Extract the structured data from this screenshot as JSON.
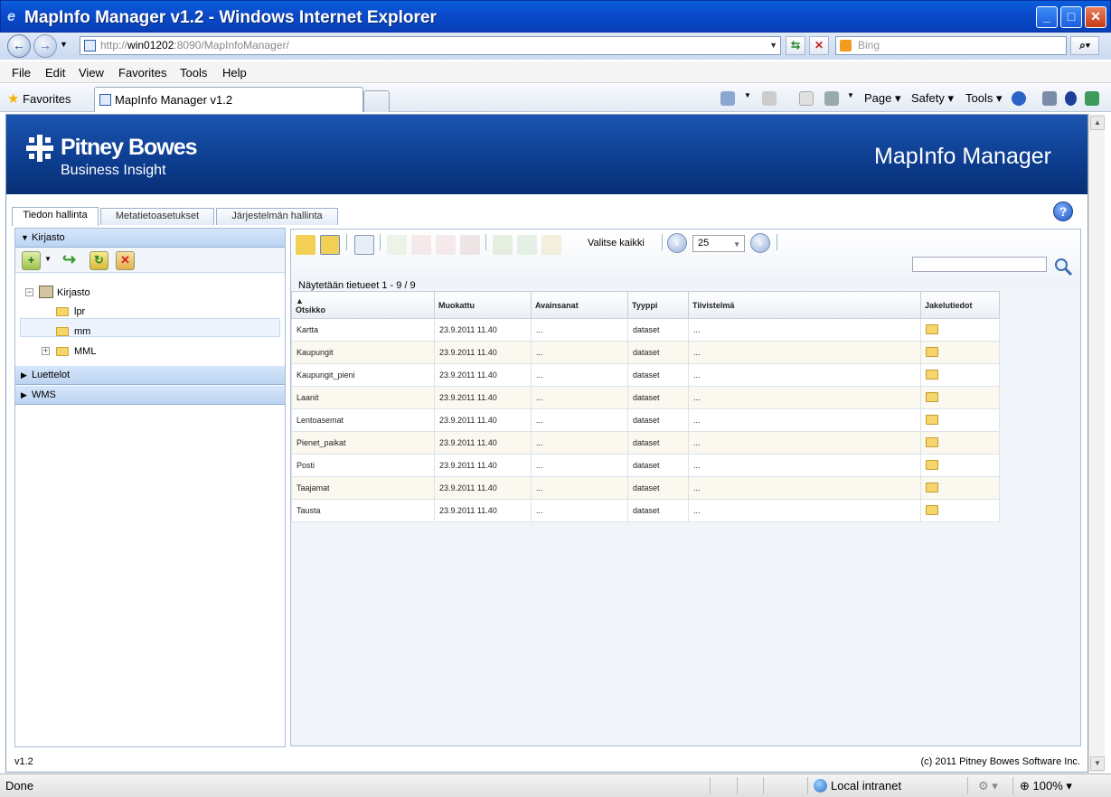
{
  "window": {
    "title": "MapInfo Manager v1.2 - Windows Internet Explorer"
  },
  "address": {
    "url_gray": "http://",
    "url_host": "win01202",
    "url_rest": ":8090/MapInfoManager/",
    "search_placeholder": "Bing"
  },
  "menu": [
    "File",
    "Edit",
    "View",
    "Favorites",
    "Tools",
    "Help"
  ],
  "favorites": {
    "label": "Favorites",
    "tab_title": "MapInfo Manager v1.2"
  },
  "commands": {
    "page": "Page",
    "safety": "Safety",
    "tools": "Tools"
  },
  "header": {
    "brand": "Pitney Bowes",
    "sub": "Business Insight",
    "app_title": "MapInfo Manager"
  },
  "tabs": [
    "Tiedon hallinta",
    "Metatietoasetukset",
    "Järjestelmän hallinta"
  ],
  "left": {
    "accordion": [
      "Kirjasto",
      "Luettelot",
      "WMS"
    ],
    "tree": {
      "root": "Kirjasto",
      "children": [
        "lpr",
        "mm",
        "MML"
      ]
    }
  },
  "toolbar": {
    "select_all": "Valitse kaikki",
    "page_size": "25"
  },
  "grid": {
    "showing": "Näytetään tietueet 1 - 9 / 9",
    "sort_marker": "▲",
    "columns": [
      "Otsikko",
      "Muokattu",
      "Avainsanat",
      "Tyyppi",
      "Tiivistelmä",
      "Jakelutiedot"
    ],
    "rows": [
      [
        "Kartta",
        "23.9.2011 11.40",
        "...",
        "dataset",
        "..."
      ],
      [
        "Kaupungit",
        "23.9.2011 11.40",
        "...",
        "dataset",
        "..."
      ],
      [
        "Kaupungit_pieni",
        "23.9.2011 11.40",
        "...",
        "dataset",
        "..."
      ],
      [
        "Laanit",
        "23.9.2011 11.40",
        "...",
        "dataset",
        "..."
      ],
      [
        "Lentoasemat",
        "23.9.2011 11.40",
        "...",
        "dataset",
        "..."
      ],
      [
        "Pienet_paikat",
        "23.9.2011 11.40",
        "...",
        "dataset",
        "..."
      ],
      [
        "Posti",
        "23.9.2011 11.40",
        "...",
        "dataset",
        "..."
      ],
      [
        "Taajamat",
        "23.9.2011 11.40",
        "...",
        "dataset",
        "..."
      ],
      [
        "Tausta",
        "23.9.2011 11.40",
        "...",
        "dataset",
        "..."
      ]
    ]
  },
  "footer": {
    "version": "v1.2",
    "copyright": "(c) 2011 Pitney Bowes Software Inc."
  },
  "status": {
    "left": "Done",
    "zone": "Local intranet",
    "zoom": "100%"
  }
}
